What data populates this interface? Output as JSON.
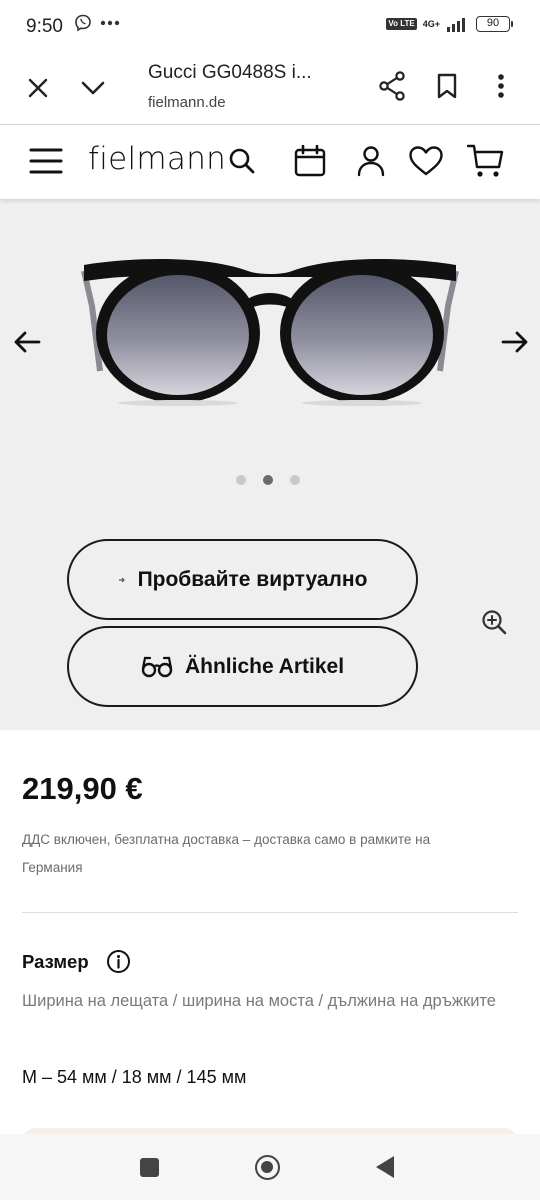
{
  "status": {
    "time": "9:50",
    "network": "4G+",
    "volte": "Vo LTE",
    "battery": "90"
  },
  "browser": {
    "title": "Gucci GG0488S i...",
    "url": "fielmann.de",
    "icons": [
      "close-icon",
      "chevron-down-icon",
      "share-icon",
      "bookmark-icon",
      "more-vert-icon"
    ]
  },
  "site": {
    "logo": "fielmann",
    "icons": [
      "menu-icon",
      "search-icon",
      "calendar-icon",
      "account-icon",
      "heart-icon",
      "cart-icon"
    ]
  },
  "gallery": {
    "slide_count": 3,
    "active_slide": 2,
    "try_on_label": "Пробвайте виртуално",
    "similar_label": "Ähnliche Artikel"
  },
  "product": {
    "price": "219,90 €",
    "tax_note": "ДДС включен, безплатна доставка – доставка само в рамките на Германия",
    "size_title": "Размер",
    "size_desc": "Ширина на лещата / ширина на моста / дължина на дръжките",
    "size_value": "M – 54 мм / 18 мм / 145 мм"
  },
  "colors": {
    "accent": "#1a1a1a",
    "gallery_bg": "#efeff0",
    "muted_text": "#6b6b6b"
  }
}
